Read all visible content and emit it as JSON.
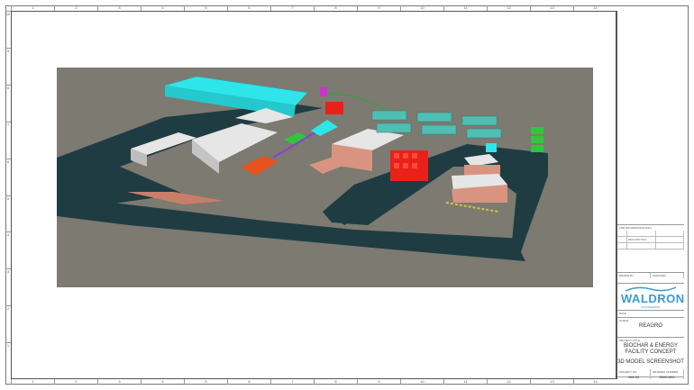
{
  "ruler": {
    "columns": [
      "1",
      "2",
      "3",
      "4",
      "5",
      "6",
      "7",
      "8",
      "9",
      "10",
      "11",
      "12",
      "13",
      "14"
    ],
    "rows": [
      "10",
      "9",
      "8",
      "7",
      "6",
      "5",
      "4",
      "3",
      "2",
      "1"
    ]
  },
  "titleblock": {
    "issue_header": "FOR INFORMATION ONLY",
    "revision_note": "DESCRIPTION",
    "small_label_1": "DRAWN BY",
    "small_label_2": "CHECKED",
    "small_label_3": "DATE",
    "logo_text": "WALDRON",
    "logo_sub": "ENGINEERING",
    "client_label": "CLIENT",
    "client": "REAGRO",
    "project_label": "PROJECT TITLE",
    "project_title_line1": "BIOCHAR & ENERGY",
    "project_title_line2": "FACILITY CONCEPT",
    "drawing_title": "3D MODEL SCREENSHOT",
    "drawing_no_label": "DRAWING NUMBER",
    "project_no_label": "PROJECT NO.",
    "project_no": "408-02",
    "drawing_no": "6000-002"
  },
  "colors": {
    "ground": "#7c7a71",
    "road": "#1f3c43",
    "building": "#dcdcdc",
    "brick": "#d89480",
    "cyan": "#2ee6ea",
    "red": "#e8221a",
    "orange": "#e6531c",
    "green": "#32c43c",
    "teal_tank": "#4fbfb4",
    "logo_blue": "#3a9bd0"
  }
}
